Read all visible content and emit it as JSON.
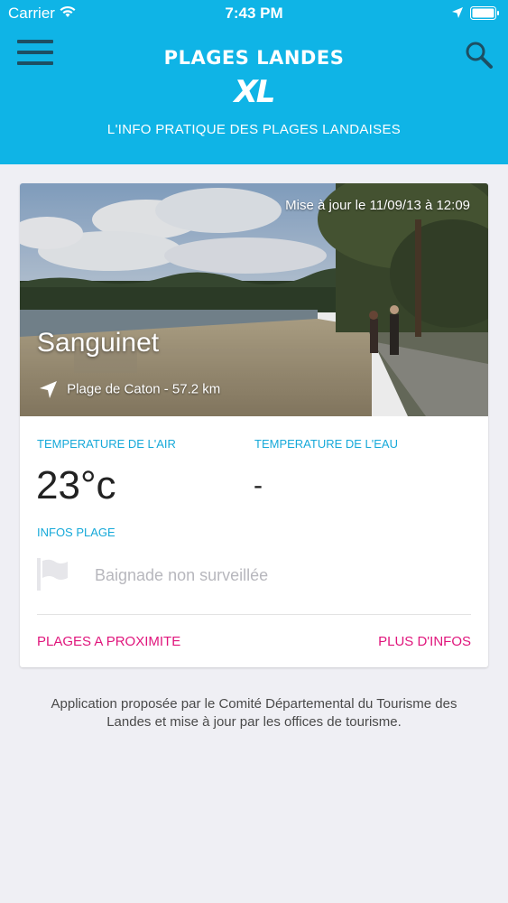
{
  "status_bar": {
    "carrier": "Carrier",
    "time": "7:43 PM"
  },
  "header": {
    "brand": "PLAGES LANDES",
    "logo_text": "XL",
    "tagline": "L'INFO PRATIQUE DES PLAGES LANDAISES",
    "menu_icon": "hamburger-icon",
    "search_icon": "search-icon",
    "background_color": "#0fb4e6"
  },
  "card": {
    "updated": "Mise à jour le 11/09/13 à 12:09",
    "beach_name": "Sanguinet",
    "place": "Plage de Caton - 57.2 km",
    "air_temp_label": "TEMPERATURE DE L'AIR",
    "air_temp_value": "23°c",
    "water_temp_label": "TEMPERATURE DE L'EAU",
    "water_temp_value": "-",
    "infos_label": "INFOS PLAGE",
    "swim_status": "Baignade non surveillée",
    "nearby_link": "PLAGES A PROXIMITE",
    "more_link": "PLUS D'INFOS",
    "accent_blue": "#16a9d9",
    "accent_pink": "#e0157c"
  },
  "footer": {
    "text": "Application proposée par le Comité Départemental du Tourisme des Landes et mise à jour par les offices de tourisme."
  }
}
